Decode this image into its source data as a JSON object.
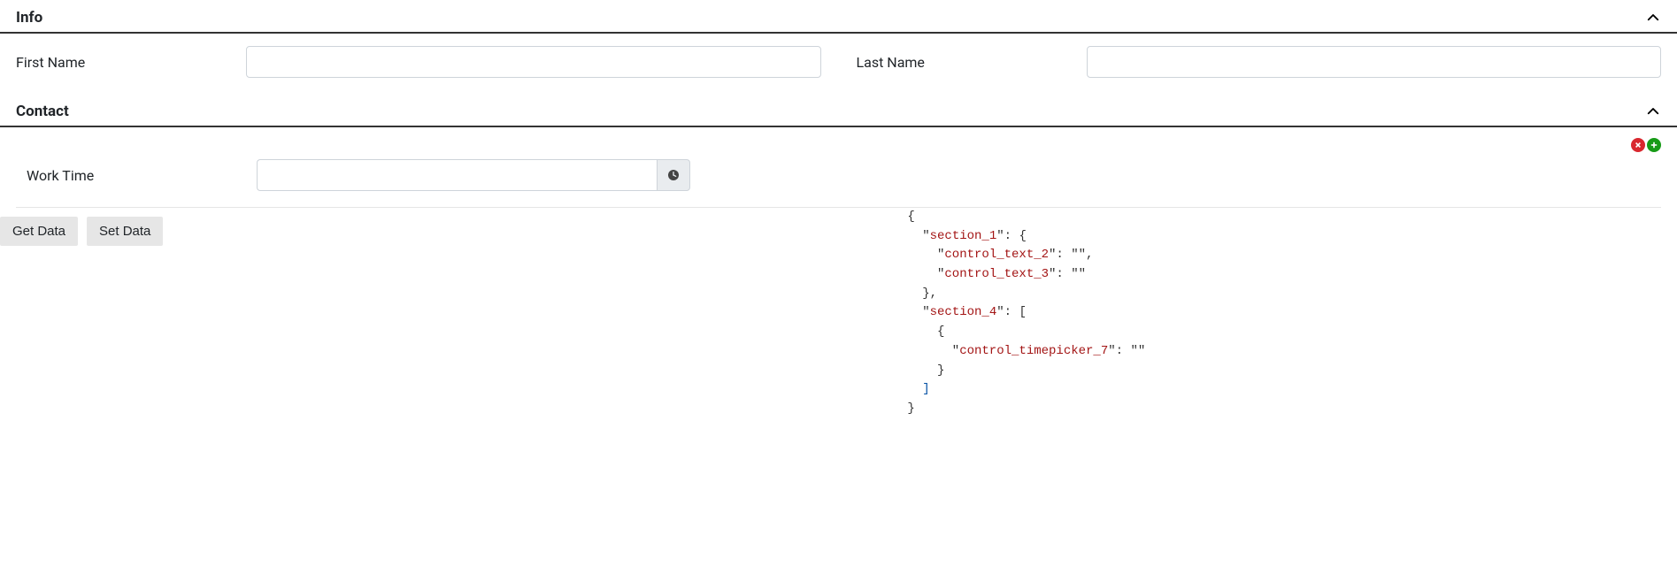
{
  "sections": {
    "info": {
      "title": "Info",
      "fields": {
        "first_name": {
          "label": "First Name",
          "value": ""
        },
        "last_name": {
          "label": "Last Name",
          "value": ""
        }
      }
    },
    "contact": {
      "title": "Contact",
      "fields": {
        "work_time": {
          "label": "Work Time",
          "value": ""
        }
      }
    }
  },
  "buttons": {
    "get_data": "Get Data",
    "set_data": "Set Data"
  },
  "json_output": {
    "l1": "{",
    "l2a": "  \"",
    "l2b": "section_1",
    "l2c": "\": {",
    "l3a": "    \"",
    "l3b": "control_text_2",
    "l3c": "\": \"",
    "l3d": "",
    "l3e": "\",",
    "l4a": "    \"",
    "l4b": "control_text_3",
    "l4c": "\": \"",
    "l4d": "",
    "l4e": "\"",
    "l5": "  },",
    "l6a": "  \"",
    "l6b": "section_4",
    "l6c": "\": [",
    "l7": "    {",
    "l8a": "      \"",
    "l8b": "control_timepicker_7",
    "l8c": "\": \"",
    "l8d": "",
    "l8e": "\"",
    "l9": "    }",
    "l10": "  ]",
    "l11": "}"
  }
}
